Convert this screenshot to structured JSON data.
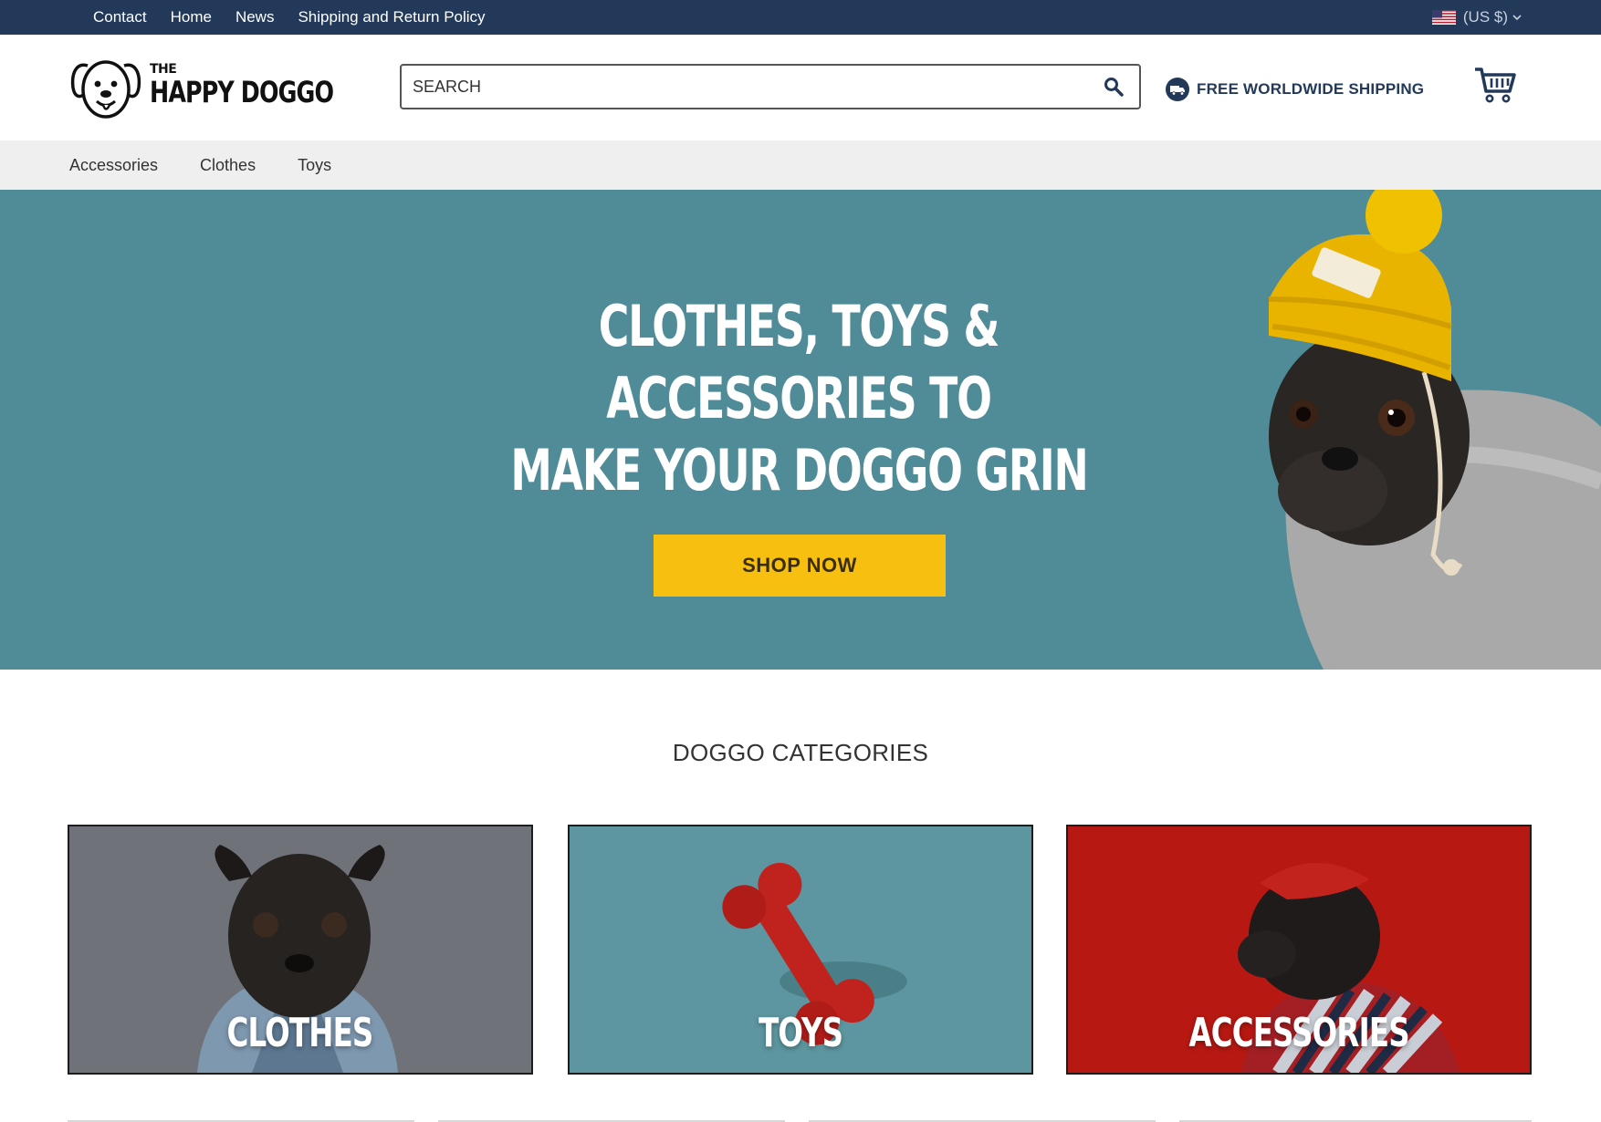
{
  "topbar": {
    "links": [
      "Contact",
      "Home",
      "News",
      "Shipping and Return Policy"
    ],
    "currency": "(US $)",
    "currency_flag_icon": "us-flag-icon"
  },
  "header": {
    "logo": {
      "the": "THE",
      "name": "HAPPY DOGGO"
    },
    "search_placeholder": "SEARCH",
    "shipping_text": "FREE WORLDWIDE SHIPPING"
  },
  "nav": {
    "items": [
      "Accessories",
      "Clothes",
      "Toys"
    ]
  },
  "hero": {
    "line1": "CLOTHES, TOYS & ACCESSORIES TO",
    "line2": "MAKE YOUR DOGGO GRIN",
    "cta": "SHOP NOW"
  },
  "categories": {
    "heading": "DOGGO CATEGORIES",
    "cards": [
      {
        "label": "CLOTHES"
      },
      {
        "label": "TOYS"
      },
      {
        "label": "ACCESSORIES"
      }
    ]
  },
  "colors": {
    "topbar": "#22395a",
    "hero_bg": "#508b98",
    "cta": "#f7c010",
    "nav_bg": "#efeff0"
  }
}
